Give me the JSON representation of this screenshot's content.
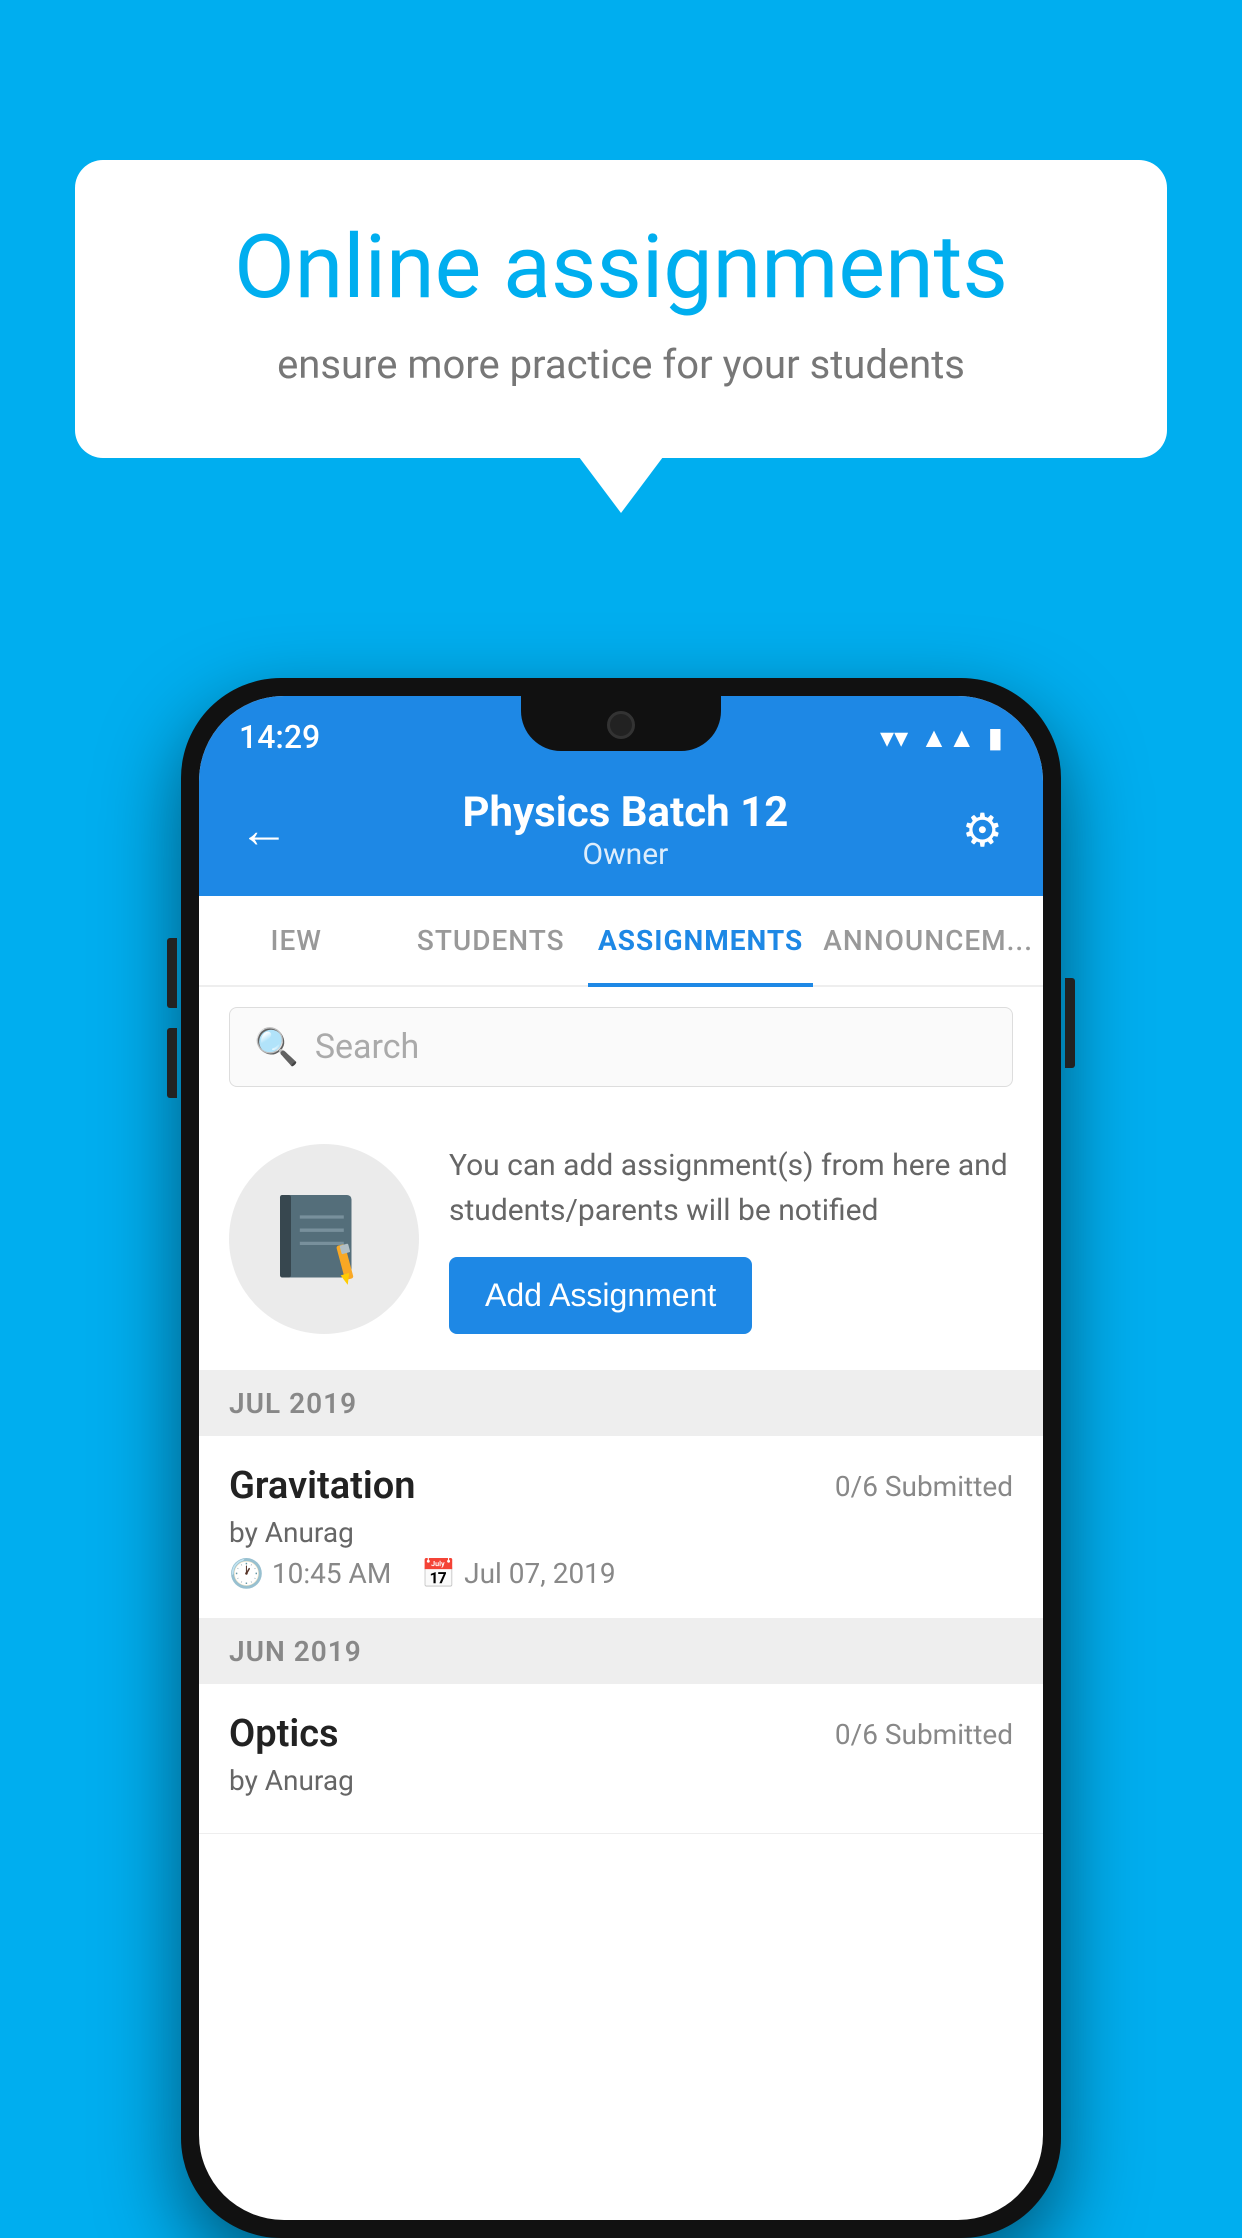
{
  "background_color": "#00AEEF",
  "speech_bubble": {
    "heading": "Online assignments",
    "subtext": "ensure more practice for your students"
  },
  "status_bar": {
    "time": "14:29",
    "wifi": "▼",
    "signal": "▲",
    "battery": "▮"
  },
  "top_bar": {
    "title": "Physics Batch 12",
    "subtitle": "Owner",
    "back_label": "←",
    "settings_label": "⚙"
  },
  "tabs": [
    {
      "label": "IEW",
      "active": false
    },
    {
      "label": "STUDENTS",
      "active": false
    },
    {
      "label": "ASSIGNMENTS",
      "active": true
    },
    {
      "label": "ANNOUNCEM...",
      "active": false
    }
  ],
  "search": {
    "placeholder": "Search"
  },
  "add_assignment": {
    "description": "You can add assignment(s) from here and students/parents will be notified",
    "button_label": "Add Assignment"
  },
  "sections": [
    {
      "header": "JUL 2019",
      "assignments": [
        {
          "title": "Gravitation",
          "submitted": "0/6 Submitted",
          "author": "by Anurag",
          "time": "10:45 AM",
          "date": "Jul 07, 2019"
        }
      ]
    },
    {
      "header": "JUN 2019",
      "assignments": [
        {
          "title": "Optics",
          "submitted": "0/6 Submitted",
          "author": "by Anurag",
          "time": "",
          "date": ""
        }
      ]
    }
  ],
  "icons": {
    "back": "←",
    "settings": "⚙",
    "search": "🔍",
    "clock": "🕐",
    "calendar": "📅"
  }
}
